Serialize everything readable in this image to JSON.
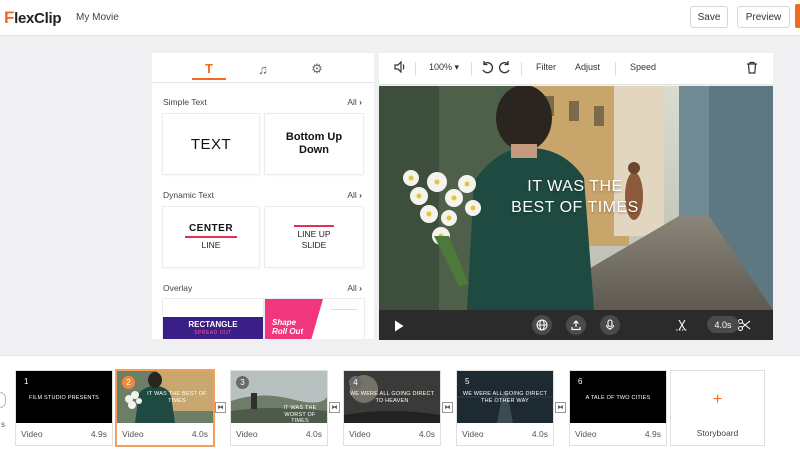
{
  "header": {
    "logo": "FlexClip",
    "project_name": "My Movie",
    "save_label": "Save",
    "preview_label": "Preview"
  },
  "panel": {
    "tabs": [
      {
        "icon": "text-icon",
        "glyph": "T",
        "active": true
      },
      {
        "icon": "music-icon",
        "glyph": "♫",
        "active": false
      },
      {
        "icon": "settings-icon",
        "glyph": "⚙",
        "active": false
      }
    ],
    "sections": [
      {
        "title": "Simple Text",
        "all_label": "All",
        "cards": [
          {
            "text": "TEXT"
          },
          {
            "line1": "Bottom Up",
            "line2": "Down"
          }
        ]
      },
      {
        "title": "Dynamic Text",
        "all_label": "All",
        "cards": [
          {
            "line1": "CENTER",
            "line2": "LINE"
          },
          {
            "line1": "LINE UP",
            "line2": "SLIDE"
          }
        ]
      },
      {
        "title": "Overlay",
        "all_label": "All",
        "cards": [
          {
            "line1": "RECTANGLE",
            "line2": "SPREAD OUT"
          },
          {
            "line1": "Shape",
            "line2": "Roll Out"
          }
        ]
      }
    ]
  },
  "toolbar": {
    "zoom": "100%",
    "filter_label": "Filter",
    "adjust_label": "Adjust",
    "speed_label": "Speed"
  },
  "preview": {
    "caption_line1": "IT WAS THE",
    "caption_line2": "BEST OF TIMES",
    "duration": "4.0s"
  },
  "timeline": {
    "clips": [
      {
        "number": "1",
        "type": "Video",
        "duration": "4.9s",
        "text": "FILM STUDIO PRESENTS"
      },
      {
        "number": "2",
        "type": "Video",
        "duration": "4.0s",
        "text": "IT WAS THE BEST OF TIMES",
        "selected": true
      },
      {
        "number": "3",
        "type": "Video",
        "duration": "4.0s",
        "text": "IT WAS THE WORST OF TIMES"
      },
      {
        "number": "4",
        "type": "Video",
        "duration": "4.0s",
        "text": "WE WERE ALL GOING DIRECT TO HEAVEN"
      },
      {
        "number": "5",
        "type": "Video",
        "duration": "4.0s",
        "text": "WE WERE ALL GOING DIRECT THE OTHER WAY"
      },
      {
        "number": "6",
        "type": "Video",
        "duration": "4.9s",
        "text": "A TALE OF TWO CITIES"
      }
    ],
    "storyboard_label": "Storyboard",
    "left_edge_text": "s"
  },
  "colors": {
    "accent": "#f26b21",
    "panel_bg": "#ffffff",
    "app_bg": "#f0f0f2",
    "control_bar": "#2b2b2b"
  }
}
